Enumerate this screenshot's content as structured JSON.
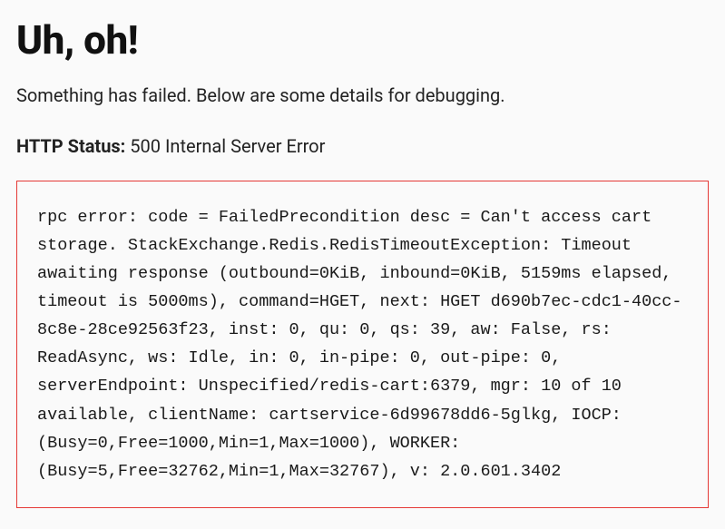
{
  "heading": "Uh, oh!",
  "subtitle": "Something has failed. Below are some details for debugging.",
  "status": {
    "label": "HTTP Status:",
    "value": "500 Internal Server Error"
  },
  "error_message": "rpc error: code = FailedPrecondition desc = Can't access cart storage. StackExchange.Redis.RedisTimeoutException: Timeout awaiting response (outbound=0KiB, inbound=0KiB, 5159ms elapsed, timeout is 5000ms), command=HGET, next: HGET d690b7ec-cdc1-40cc-8c8e-28ce92563f23, inst: 0, qu: 0, qs: 39, aw: False, rs: ReadAsync, ws: Idle, in: 0, in-pipe: 0, out-pipe: 0, serverEndpoint: Unspecified/redis-cart:6379, mgr: 10 of 10 available, clientName: cartservice-6d99678dd6-5glkg, IOCP: (Busy=0,Free=1000,Min=1,Max=1000), WORKER: (Busy=5,Free=32762,Min=1,Max=32767), v: 2.0.601.3402"
}
